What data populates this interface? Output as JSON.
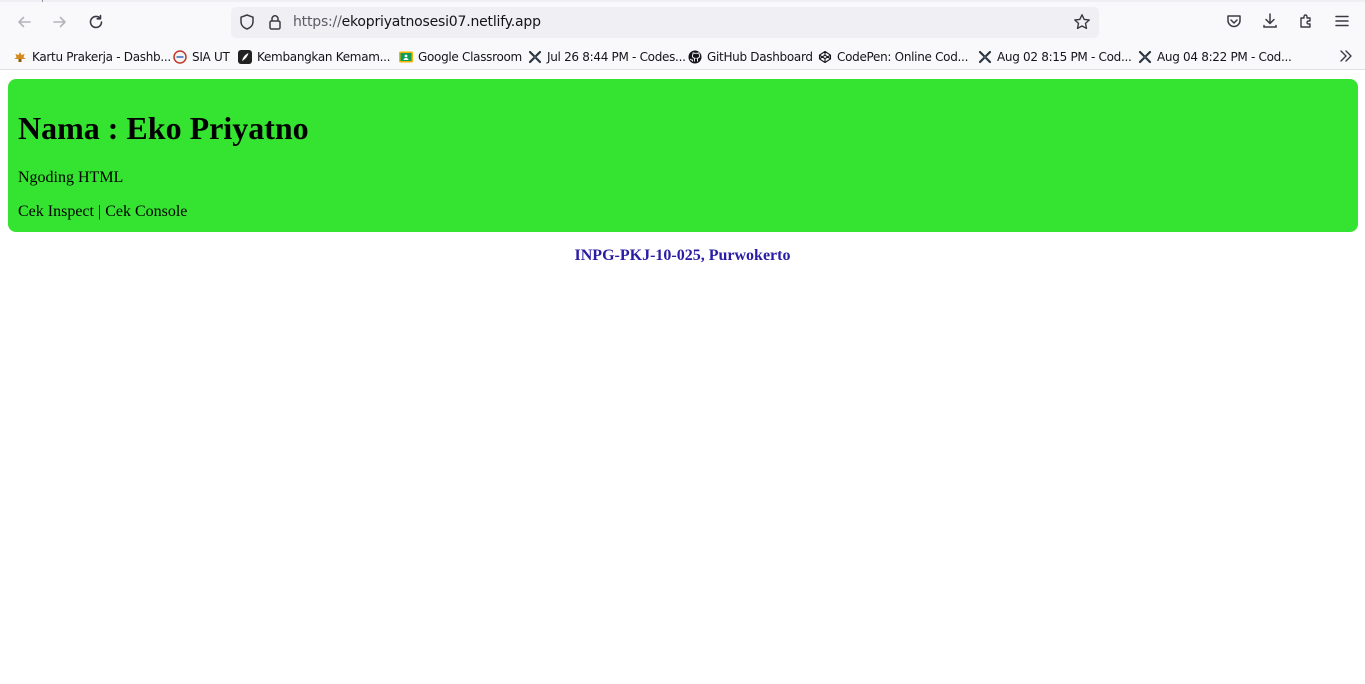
{
  "browser": {
    "url_protocol": "https://",
    "url_host": "ekopriyatnosesi07.netlify.app",
    "bookmarks": [
      {
        "label": "Kartu Prakerja - Dashb...",
        "icon": "prakerja-icon"
      },
      {
        "label": "SIA UT",
        "icon": "ut-icon"
      },
      {
        "label": "Kembangkan Kemam...",
        "icon": "feather-icon"
      },
      {
        "label": "Google Classroom",
        "icon": "classroom-icon"
      },
      {
        "label": "Jul 26 8:44 PM - Codes...",
        "icon": "codesandbox-icon"
      },
      {
        "label": "GitHub Dashboard",
        "icon": "github-icon"
      },
      {
        "label": "CodePen: Online Cod...",
        "icon": "codepen-icon"
      },
      {
        "label": "Aug 02 8:15 PM - Cod...",
        "icon": "codesandbox-icon"
      },
      {
        "label": "Aug 04 8:22 PM - Cod...",
        "icon": "codesandbox-icon"
      }
    ]
  },
  "page": {
    "heading": "Nama : Eko Priyatno",
    "subtitle": "Ngoding HTML",
    "link_inspect": "Cek Inspect",
    "link_separator": " | ",
    "link_console": "Cek Console",
    "footer": "INPG-PKJ-10-025, Purwokerto"
  },
  "colors": {
    "card_bg": "#34e431",
    "footer_text": "#2a1ca4"
  }
}
